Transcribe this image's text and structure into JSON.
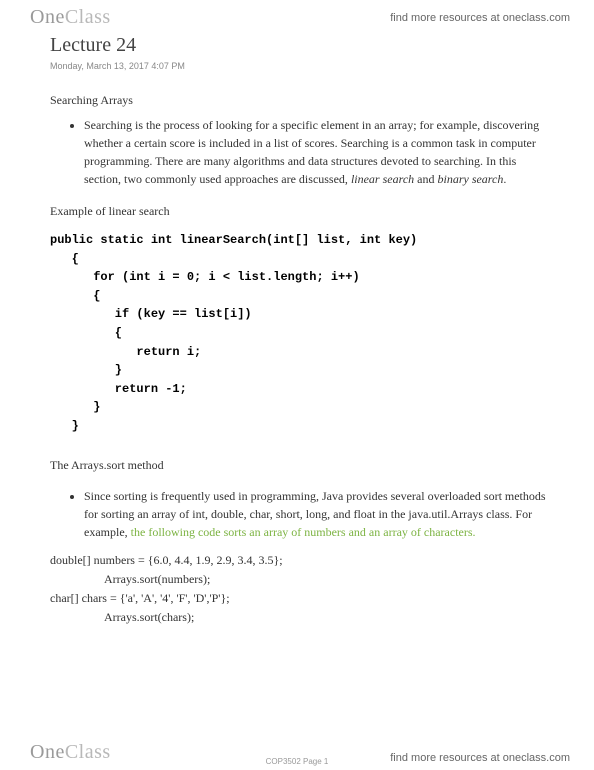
{
  "brand": {
    "logo_one": "One",
    "logo_class": "Class",
    "resources_text": "find more resources at oneclass.com"
  },
  "document": {
    "title": "Lecture 24",
    "timestamp": "Monday, March 13, 2017    4:07 PM",
    "section1_heading": "Searching Arrays",
    "section1_bullet_a": "Searching is the process of looking for a specific element in an array; for example, discovering whether a certain score is included in a list of scores. Searching is a common task in computer programming. There are many algorithms and data structures devoted to searching. In this section, two commonly used approaches are discussed, ",
    "section1_bullet_italic1": "linear search",
    "section1_bullet_mid": " and ",
    "section1_bullet_italic2": "binary search",
    "section1_bullet_end": ".",
    "example_heading": "Example of linear search",
    "code": "public static int linearSearch(int[] list, int key)\n   {\n      for (int i = 0; i < list.length; i++)\n      {\n         if (key == list[i])\n         {\n            return i;\n         }\n         return -1;\n      }\n   }",
    "section2_heading": "The Arrays.sort method",
    "section2_bullet_a": "Since sorting is frequently used in programming, Java provides several overloaded sort methods for sorting an array of int, double, char, short, long, and float in the java.util.Arrays class. For example, ",
    "section2_bullet_hl": "the following code sorts an array of numbers and an array of characters.",
    "codeline1": "double[] numbers = {6.0, 4.4, 1.9, 2.9, 3.4, 3.5};",
    "codeline2": "Arrays.sort(numbers);",
    "codeline3": "char[] chars = {'a', 'A', '4', 'F', 'D','P'};",
    "codeline4": "Arrays.sort(chars);",
    "footer_page": "COP3502 Page 1"
  }
}
